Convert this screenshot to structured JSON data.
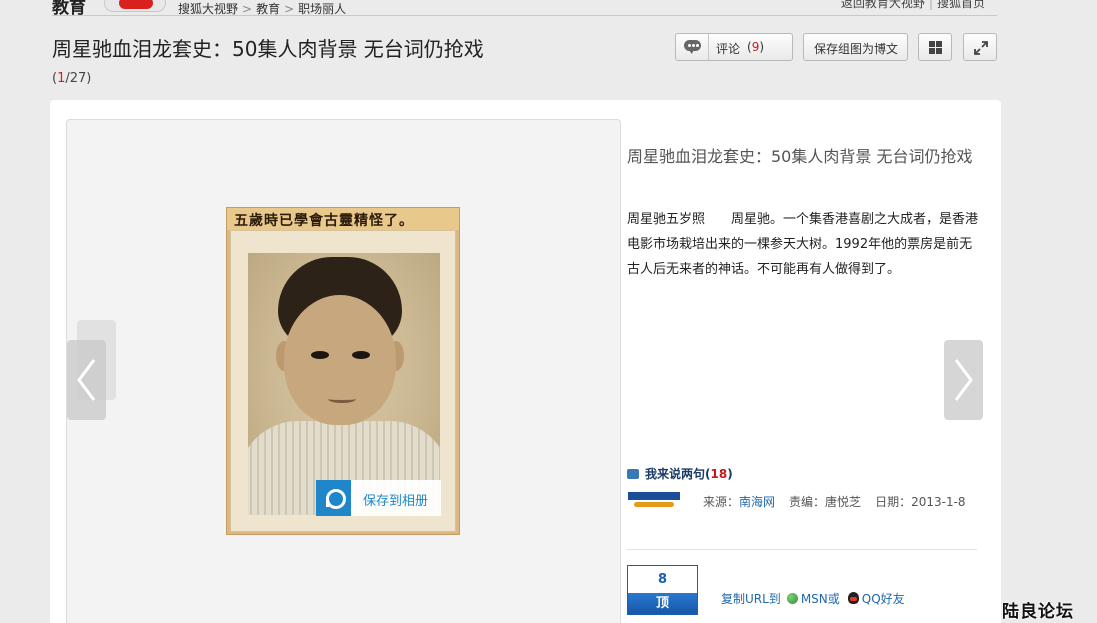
{
  "header": {
    "channel": "教育",
    "brand_mark": "sohu-video-logo",
    "breadcrumbs": [
      "搜狐大视野",
      "教育",
      "职场丽人"
    ],
    "breadcrumb_sep": ">",
    "right_links": [
      "返回教育大视野",
      "搜狐首页"
    ]
  },
  "gallery": {
    "title": "周星驰血泪龙套史：50集人肉背景 无台词仍抢戏",
    "counter_open": "(",
    "current": "1",
    "counter_sep": "/",
    "total": "27",
    "counter_close": ")"
  },
  "toolbar": {
    "comment_label": "评论",
    "comment_open": "(",
    "comment_count": "9",
    "comment_close": ")",
    "save_blog_label": "保存组图为博文",
    "grid_icon": "grid-icon",
    "fullscreen_icon": "fullscreen-icon"
  },
  "photo": {
    "caption_banner": "五歲時已學會古靈精怪了。",
    "save_album_label": "保存到相册"
  },
  "info": {
    "title": "周星驰血泪龙套史：50集人肉背景 无台词仍抢戏",
    "description": "周星驰五岁照　　周星驰。一个集香港喜剧之大成者，是香港电影市场栽培出来的一棵参天大树。1992年他的票房是前无古人后无来者的神话。不可能再有人做得到了。",
    "talk_label": "我来说两句",
    "talk_open": "(",
    "talk_count": "18",
    "talk_close": ")",
    "source_label": "来源：",
    "source_name": "南海网",
    "editor_label": "责编：",
    "editor_name": "唐悦芝",
    "date_label": "日期：",
    "date": "2013-1-8"
  },
  "vote": {
    "count": "8",
    "label": "顶"
  },
  "share": {
    "copy_url": "复制URL到",
    "msn": "MSN或",
    "qq": "QQ好友"
  },
  "watermark": "陆良论坛",
  "colors": {
    "accent_red": "#c81818",
    "link_blue": "#1f68ad",
    "vote_blue": "#1c5fab",
    "album_blue": "#1f87c9"
  }
}
